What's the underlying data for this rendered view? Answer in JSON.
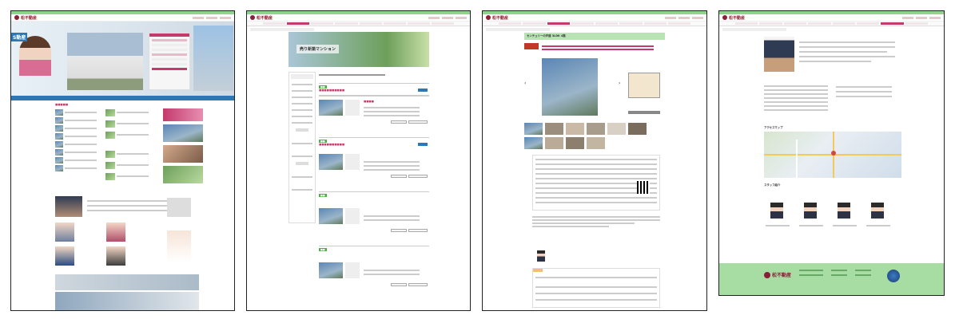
{
  "brand": {
    "name": "松不動産",
    "accent": "#c43a6b",
    "green": "#8fd48b",
    "brand_color": "#8b1d38"
  },
  "shot1": {
    "hero_text": "S動産"
  },
  "shot2": {
    "banner_title": "売り新築マンション"
  },
  "shot3": {
    "property_header": "センチュリーの戸建 3LDK 4階"
  },
  "shot4": {
    "section_access": "アクセスマップ",
    "section_staff": "スタッフ紹介",
    "footer_logo": "松不動産"
  },
  "icons": [
    "home-logo-icon",
    "qr-code-icon",
    "map-icon",
    "globe-badge-icon"
  ]
}
